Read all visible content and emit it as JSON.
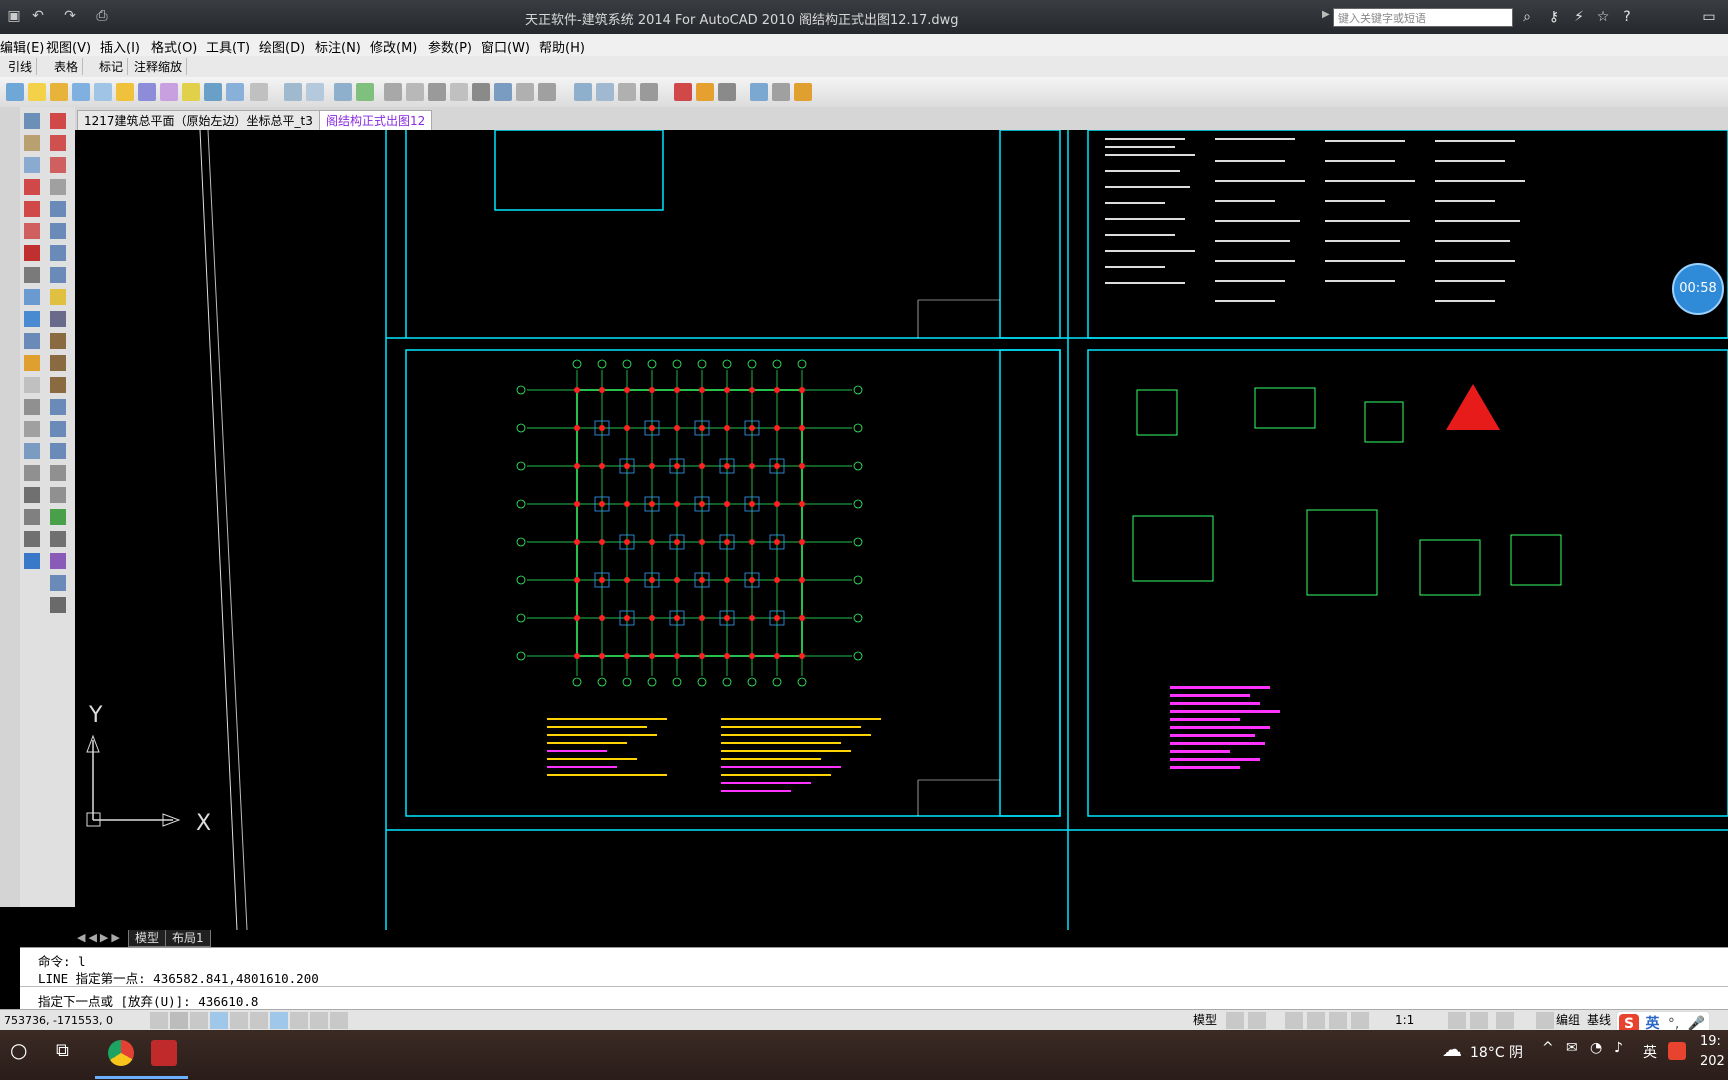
{
  "app": {
    "title": "天正软件-建筑系统 2014  For AutoCAD 2010     阁结构正式出图12.17.dwg",
    "search_placeholder": "键入关键字或短语"
  },
  "menubar": {
    "items": [
      "编辑(E)",
      "视图(V)",
      "插入(I)",
      "格式(O)",
      "工具(T)",
      "绘图(D)",
      "标注(N)",
      "修改(M)",
      "参数(P)",
      "窗口(W)",
      "帮助(H)"
    ]
  },
  "toolbar1": {
    "items": [
      "引线",
      "表格",
      "标记",
      "注释缩放"
    ]
  },
  "doc_tabs": {
    "tab1": "1217建筑总平面（原始左边）坐标总平_t3",
    "tab2": "阁结构正式出图12"
  },
  "ucs": {
    "y_label": "Y",
    "x_label": "X"
  },
  "layout_tabs": {
    "model": "模型",
    "layout1": "布局1"
  },
  "command": {
    "line1": "命令: l",
    "line2": "LINE 指定第一点: 436582.841,4801610.200",
    "line3": "指定下一点或 [放弃(U)]: 436610.8"
  },
  "status": {
    "coords": "753736, -171553, 0",
    "model_btn": "模型",
    "scale": "1:1",
    "edit_group": "编组",
    "baseline": "基线"
  },
  "timer": {
    "value": "00:58"
  },
  "sogou": {
    "lang": "英"
  },
  "taskbar": {
    "weather": "18°C 阴",
    "lang": "英",
    "time": "19:",
    "date": "202"
  },
  "colors": {
    "frame_cyan": "#00e5ff",
    "grid_green": "#33ff66",
    "column_red": "#ff2222",
    "text_yellow": "#ffd400",
    "text_magenta": "#ff33ff",
    "dim_blue": "#3aa0ff"
  }
}
